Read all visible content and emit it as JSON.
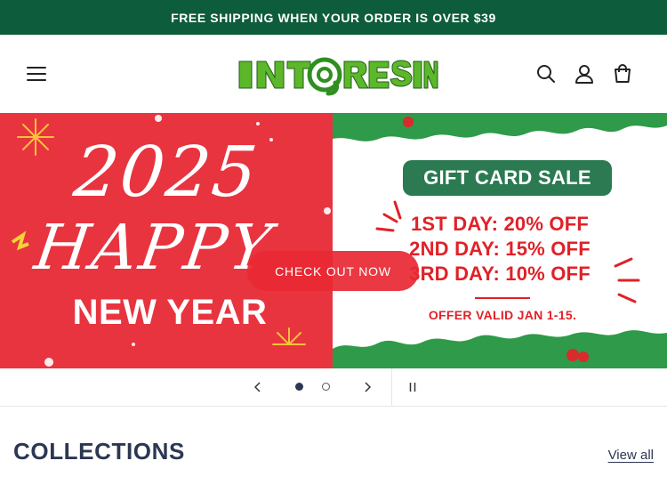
{
  "announcement": {
    "text": "FREE SHIPPING WHEN YOUR ORDER IS OVER $39"
  },
  "header": {
    "logo_text": "INTORESIN",
    "icons": [
      "menu-icon",
      "search-icon",
      "account-icon",
      "cart-icon"
    ]
  },
  "banner": {
    "left": {
      "year": "2025",
      "happy": "HAPPY",
      "new_year": "NEW YEAR"
    },
    "right": {
      "gift_card": "GIFT CARD SALE",
      "deals": [
        "1ST DAY: 20% OFF",
        "2ND DAY: 15% OFF",
        "3RD DAY: 10% OFF"
      ],
      "offer": "OFFER VALID JAN 1-15."
    },
    "cta_label": "CHECK OUT NOW"
  },
  "slider": {
    "slide_count": 2,
    "active_slide": 1,
    "icons": [
      "chevron-left-icon",
      "chevron-right-icon",
      "pause-icon"
    ]
  },
  "collections": {
    "title": "COLLECTIONS",
    "view_all": "View all"
  },
  "colors": {
    "announcement_bg": "#0d5c3b",
    "banner_red": "#e8343f",
    "brand_green": "#2b7a52",
    "heading_navy": "#2b3753",
    "deal_red": "#e02128"
  }
}
